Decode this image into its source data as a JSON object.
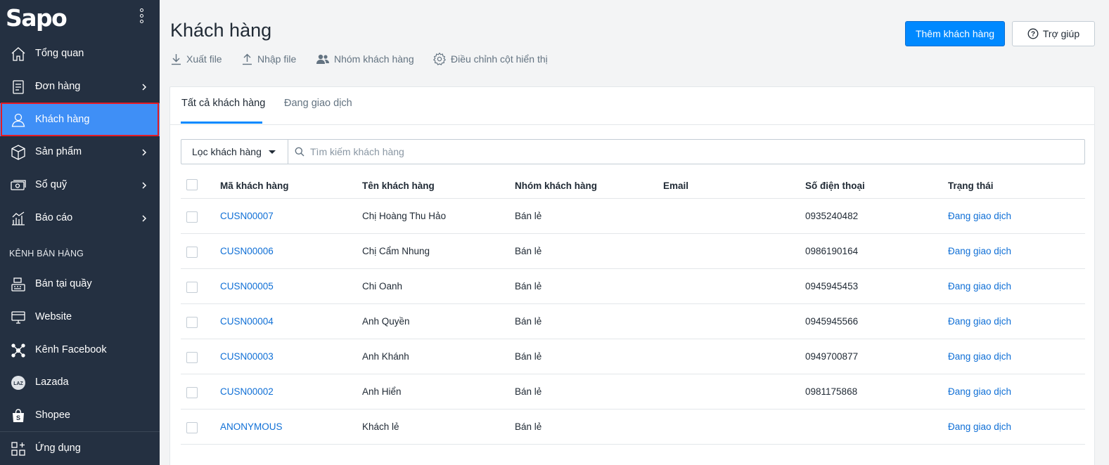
{
  "sidebar": {
    "logo": "Sapo",
    "items": [
      {
        "label": "Tổng quan",
        "icon": "home-icon"
      },
      {
        "label": "Đơn hàng",
        "icon": "order-icon"
      },
      {
        "label": "Khách hàng",
        "icon": "user-icon"
      },
      {
        "label": "Sản phẩm",
        "icon": "box-icon"
      },
      {
        "label": "Sổ quỹ",
        "icon": "cash-icon"
      },
      {
        "label": "Báo cáo",
        "icon": "chart-icon"
      }
    ],
    "section_title": "KÊNH BÁN HÀNG",
    "channels": [
      {
        "label": "Bán tại quầy",
        "icon": "pos-icon"
      },
      {
        "label": "Website",
        "icon": "website-icon"
      },
      {
        "label": "Kênh Facebook",
        "icon": "network-icon"
      },
      {
        "label": "Lazada",
        "icon": "lazada-icon",
        "badge": "LAZ"
      },
      {
        "label": "Shopee",
        "icon": "shopee-bag-icon"
      },
      {
        "label": "Ứng dụng",
        "icon": "apps-icon"
      }
    ]
  },
  "header": {
    "title": "Khách hàng",
    "toolbar": {
      "export": "Xuất file",
      "import": "Nhập file",
      "groups": "Nhóm khách hàng",
      "columns": "Điều chỉnh cột hiển thị"
    },
    "add_button": "Thêm khách hàng",
    "help_button": "Trợ giúp"
  },
  "tabs": {
    "all": "Tất cả khách hàng",
    "trading": "Đang giao dịch"
  },
  "filter": {
    "label": "Lọc khách hàng",
    "search_placeholder": "Tìm kiếm khách hàng"
  },
  "table": {
    "columns": [
      "Mã khách hàng",
      "Tên khách hàng",
      "Nhóm khách hàng",
      "Email",
      "Số điện thoại",
      "Trạng thái"
    ],
    "rows": [
      {
        "code": "CUSN00007",
        "name": "Chị Hoàng Thu Hảo",
        "group": "Bán lẻ",
        "email": "",
        "phone": "0935240482",
        "status": "Đang giao dịch"
      },
      {
        "code": "CUSN00006",
        "name": "Chị Cẩm Nhung",
        "group": "Bán lẻ",
        "email": "",
        "phone": "0986190164",
        "status": "Đang giao dịch"
      },
      {
        "code": "CUSN00005",
        "name": "Chi Oanh",
        "group": "Bán lẻ",
        "email": "",
        "phone": "0945945453",
        "status": "Đang giao dịch"
      },
      {
        "code": "CUSN00004",
        "name": "Anh Quyền",
        "group": "Bán lẻ",
        "email": "",
        "phone": "0945945566",
        "status": "Đang giao dịch"
      },
      {
        "code": "CUSN00003",
        "name": "Anh Khánh",
        "group": "Bán lẻ",
        "email": "",
        "phone": "0949700877",
        "status": "Đang giao dịch"
      },
      {
        "code": "CUSN00002",
        "name": "Anh Hiển",
        "group": "Bán lẻ",
        "email": "",
        "phone": "0981175868",
        "status": "Đang giao dịch"
      },
      {
        "code": "ANONYMOUS",
        "name": "Khách lẻ",
        "group": "Bán lẻ",
        "email": "",
        "phone": "",
        "status": "Đang giao dịch"
      }
    ]
  },
  "colors": {
    "sidebar_bg": "#243041",
    "accent": "#0089ff",
    "active_item": "#3f8ff6",
    "highlight_outline": "#e51b24",
    "link": "#0f6fd6"
  }
}
